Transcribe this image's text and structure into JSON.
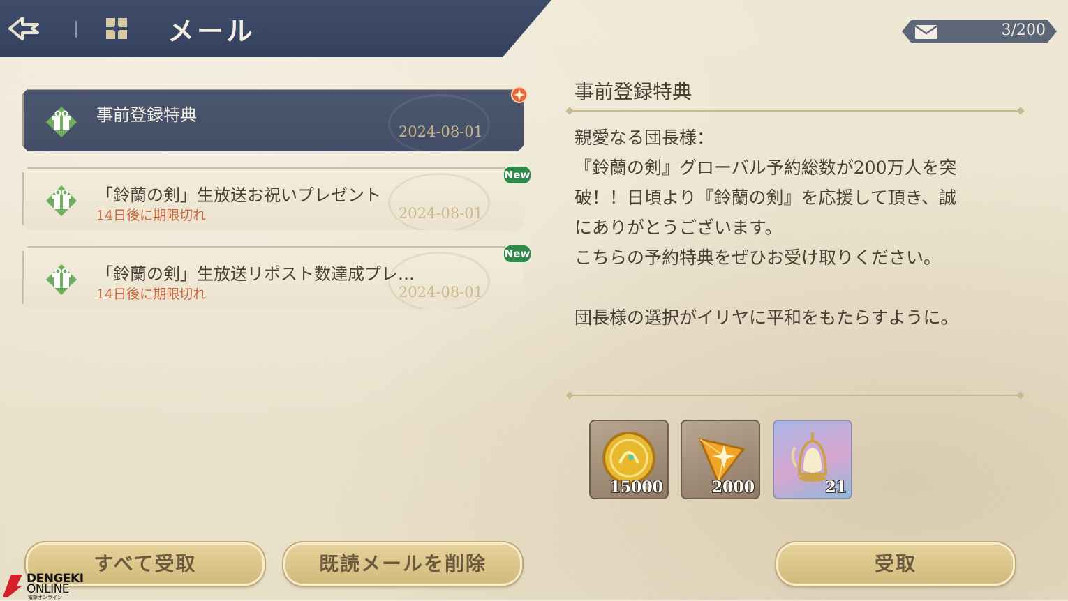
{
  "header": {
    "title": "メール"
  },
  "counter": {
    "value": "3/200"
  },
  "mails": [
    {
      "subject": "事前登録特典",
      "expiry": "",
      "date": "2024-08-01",
      "badge": ""
    },
    {
      "subject": "「鈴蘭の剣」生放送お祝いプレゼント",
      "expiry": "14日後に期限切れ",
      "date": "2024-08-01",
      "badge": "New"
    },
    {
      "subject": "「鈴蘭の剣」生放送リポスト数達成プレ…",
      "expiry": "14日後に期限切れ",
      "date": "2024-08-01",
      "badge": "New"
    }
  ],
  "detail": {
    "title": "事前登録特典",
    "lines": [
      "親愛なる団長様：",
      "『鈴蘭の剣』グローバル予約総数が200万人を突",
      "破！！日頃より『鈴蘭の剣』を応援して頂き、誠",
      "にありがとうございます。",
      "こちらの予約特典をぜひお受け取りください。",
      "",
      "団長様の選択がイリヤに平和をもたらすように。"
    ]
  },
  "rewards": [
    {
      "icon": "gold-coin-icon",
      "qty": "15000"
    },
    {
      "icon": "amber-crystal-icon",
      "qty": "2000"
    },
    {
      "icon": "bell-lantern-icon",
      "qty": "21"
    }
  ],
  "buttons": {
    "claim_all": "すべて受取",
    "delete_read": "既読メールを削除",
    "claim": "受取"
  },
  "watermark": {
    "line1": "DENGEKI",
    "line2": "ONLINE",
    "line3": "電撃オンライン"
  },
  "colors": {
    "header": "#3f4d6b",
    "expiry": "#c8643a",
    "new_badge": "#2f8a4a",
    "button": "#e0cc93"
  }
}
